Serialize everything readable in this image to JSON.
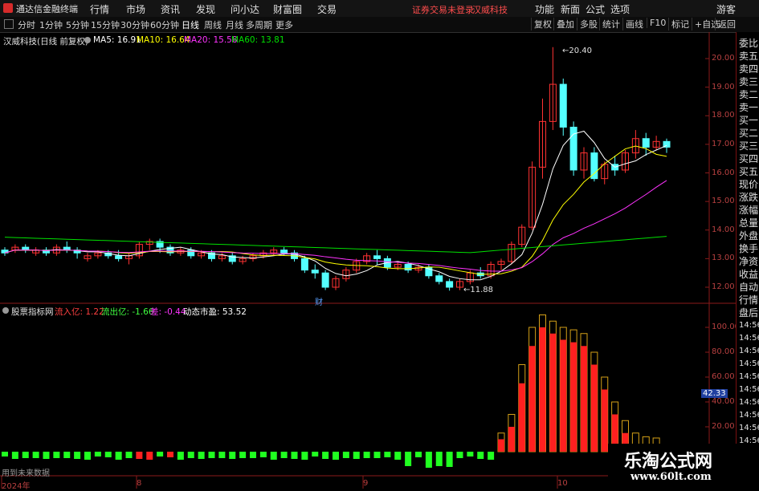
{
  "menubar": {
    "app_title": "通达信金融终端",
    "items": [
      "行情",
      "市场",
      "资讯",
      "发现",
      "问小达",
      "财富圈",
      "交易"
    ],
    "notice": "证券交易未登录",
    "stock": "汉威科技",
    "right_items": [
      "功能",
      "新面",
      "公式",
      "选项"
    ],
    "guest": "游客"
  },
  "toolbar": {
    "periods": [
      "分时",
      "1分钟",
      "5分钟",
      "15分钟",
      "30分钟",
      "60分钟",
      "日线",
      "周线",
      "月线",
      "多周期",
      "更多"
    ],
    "active": "日线",
    "right_buttons": [
      "复权",
      "叠加",
      "多股",
      "统计",
      "画线",
      "F10",
      "标记",
      "+自选",
      "返回"
    ]
  },
  "price_panel": {
    "title": "汉威科技(日线 前复权)",
    "ma5": "MA5: 16.91",
    "ma10": "MA10: 16.64",
    "ma20": "MA20: 15.58",
    "ma60": "MA60: 13.81",
    "high_label": "20.40",
    "low_label": "11.88",
    "event_tag": "财",
    "yticks": [
      "20.00",
      "19.00",
      "18.00",
      "17.00",
      "16.00",
      "15.00",
      "14.00",
      "13.00",
      "12.00"
    ]
  },
  "indicator_panel": {
    "title": "股票指标网",
    "inflow": "流入亿: 1.22",
    "outflow": "流出亿: -1.66",
    "diff": "差: -0.44",
    "pe": "动态市盈: 53.52",
    "current": "42.33",
    "yticks": [
      "100.00",
      "80.00",
      "60.00",
      "40.00",
      "20.00"
    ],
    "footer": "用到未来数据"
  },
  "xaxis": {
    "labels": [
      "2024年",
      "8",
      "9",
      "10"
    ]
  },
  "sidebar": {
    "items": [
      "委比",
      "卖五",
      "卖四",
      "卖三",
      "卖二",
      "卖一",
      "买一",
      "买二",
      "买三",
      "买四",
      "买五",
      "现价",
      "涨跌",
      "涨幅",
      "总量",
      "外盘",
      "换手",
      "净资",
      "收益"
    ],
    "bottom_items": [
      "自动",
      "行情",
      "盘后"
    ],
    "times": [
      "14:56",
      "14:56",
      "14:56",
      "14:56",
      "14:56",
      "14:56",
      "14:56",
      "14:56",
      "14:56",
      "14:56"
    ]
  },
  "watermark": {
    "name": "乐淘公式网",
    "url": "www.60lt.com"
  },
  "colors": {
    "up": "#ff3232",
    "down": "#54ffff",
    "ma5": "#ffffff",
    "ma10": "#ffff00",
    "ma20": "#ff33ff",
    "ma60": "#00e000",
    "inflow_bar": "#ff2020",
    "outflow_bar": "#20ff20",
    "bar_outline": "#d4a017"
  },
  "chart_data": {
    "type": "candlestick",
    "candles": [
      [
        13.3,
        13.4,
        13.2,
        13.1
      ],
      [
        13.3,
        13.5,
        13.4,
        13.2
      ],
      [
        13.4,
        13.5,
        13.3,
        13.2
      ],
      [
        13.2,
        13.4,
        13.3,
        13.1
      ],
      [
        13.3,
        13.4,
        13.2,
        13.1
      ],
      [
        13.2,
        13.5,
        13.4,
        13.1
      ],
      [
        13.4,
        13.6,
        13.3,
        13.2
      ],
      [
        13.3,
        13.4,
        13.2,
        13.0
      ],
      [
        13.0,
        13.2,
        13.1,
        12.9
      ],
      [
        13.1,
        13.3,
        13.2,
        13.0
      ],
      [
        13.2,
        13.3,
        13.1,
        13.0
      ],
      [
        13.1,
        13.3,
        13.0,
        12.9
      ],
      [
        13.0,
        13.2,
        13.1,
        12.8
      ],
      [
        13.1,
        13.6,
        13.5,
        13.0
      ],
      [
        13.5,
        13.7,
        13.6,
        13.3
      ],
      [
        13.6,
        13.7,
        13.4,
        13.2
      ],
      [
        13.4,
        13.5,
        13.2,
        13.1
      ],
      [
        13.2,
        13.4,
        13.3,
        13.1
      ],
      [
        13.3,
        13.4,
        13.1,
        13.0
      ],
      [
        13.1,
        13.3,
        13.2,
        13.0
      ],
      [
        13.2,
        13.3,
        13.0,
        12.9
      ],
      [
        13.0,
        13.2,
        13.1,
        12.9
      ],
      [
        13.1,
        13.2,
        12.9,
        12.8
      ],
      [
        12.9,
        13.1,
        13.0,
        12.8
      ],
      [
        13.0,
        13.2,
        13.1,
        12.9
      ],
      [
        13.1,
        13.3,
        13.2,
        13.0
      ],
      [
        13.2,
        13.4,
        13.3,
        13.1
      ],
      [
        13.3,
        13.4,
        13.2,
        13.1
      ],
      [
        13.2,
        13.3,
        13.0,
        12.9
      ],
      [
        13.0,
        13.1,
        12.6,
        12.5
      ],
      [
        12.6,
        12.8,
        12.5,
        12.3
      ],
      [
        12.5,
        12.6,
        12.0,
        11.9
      ],
      [
        12.0,
        12.4,
        12.3,
        11.9
      ],
      [
        12.3,
        12.7,
        12.6,
        12.2
      ],
      [
        12.6,
        13.0,
        12.9,
        12.5
      ],
      [
        12.9,
        13.2,
        13.1,
        12.8
      ],
      [
        13.1,
        13.3,
        13.0,
        12.8
      ],
      [
        13.0,
        13.1,
        12.7,
        12.6
      ],
      [
        12.7,
        12.9,
        12.8,
        12.6
      ],
      [
        12.8,
        12.9,
        12.6,
        12.5
      ],
      [
        12.6,
        12.8,
        12.7,
        12.5
      ],
      [
        12.7,
        12.8,
        12.4,
        12.3
      ],
      [
        12.4,
        12.5,
        12.2,
        12.1
      ],
      [
        12.2,
        12.3,
        12.0,
        11.88
      ],
      [
        12.0,
        12.3,
        12.2,
        11.9
      ],
      [
        12.2,
        12.6,
        12.5,
        12.1
      ],
      [
        12.5,
        12.7,
        12.4,
        12.3
      ],
      [
        12.4,
        12.9,
        12.8,
        12.3
      ],
      [
        12.8,
        13.0,
        12.9,
        12.6
      ],
      [
        12.9,
        13.6,
        13.5,
        12.8
      ],
      [
        13.5,
        14.2,
        14.1,
        13.4
      ],
      [
        14.1,
        16.4,
        16.2,
        14.0
      ],
      [
        16.2,
        18.6,
        17.8,
        15.8
      ],
      [
        17.8,
        20.4,
        19.1,
        17.5
      ],
      [
        19.1,
        19.3,
        17.6,
        17.3
      ],
      [
        17.6,
        17.8,
        16.1,
        15.9
      ],
      [
        16.1,
        16.9,
        16.7,
        15.8
      ],
      [
        16.7,
        16.9,
        15.8,
        15.7
      ],
      [
        15.8,
        16.4,
        16.3,
        15.6
      ],
      [
        16.3,
        16.6,
        16.1,
        15.9
      ],
      [
        16.1,
        16.8,
        16.7,
        16.0
      ],
      [
        16.7,
        17.5,
        17.2,
        16.5
      ],
      [
        17.2,
        17.4,
        16.9,
        16.6
      ],
      [
        16.9,
        17.3,
        17.1,
        16.8
      ],
      [
        17.1,
        17.2,
        16.9,
        16.7
      ]
    ],
    "flow": [
      0,
      0,
      0,
      0,
      0,
      0,
      0,
      0,
      0,
      0,
      0,
      0,
      0,
      0,
      0,
      0,
      0,
      0,
      0,
      0,
      0,
      0,
      0,
      0,
      0,
      0,
      0,
      0,
      0,
      0,
      0,
      0,
      0,
      0,
      0,
      0,
      0,
      0,
      0,
      0,
      0,
      0,
      0,
      0,
      0,
      0,
      0,
      0,
      10,
      20,
      55,
      85,
      100,
      95,
      90,
      88,
      85,
      70,
      50,
      30,
      15,
      5,
      2,
      1,
      0
    ],
    "flow_outline": [
      0,
      0,
      0,
      0,
      0,
      0,
      0,
      0,
      0,
      0,
      0,
      0,
      0,
      0,
      0,
      0,
      0,
      0,
      0,
      0,
      0,
      0,
      0,
      0,
      0,
      0,
      0,
      0,
      0,
      0,
      0,
      0,
      0,
      0,
      0,
      0,
      0,
      0,
      0,
      0,
      0,
      0,
      0,
      0,
      0,
      0,
      0,
      0,
      15,
      30,
      70,
      100,
      110,
      105,
      100,
      98,
      95,
      80,
      60,
      40,
      25,
      15,
      12,
      11,
      0
    ]
  }
}
